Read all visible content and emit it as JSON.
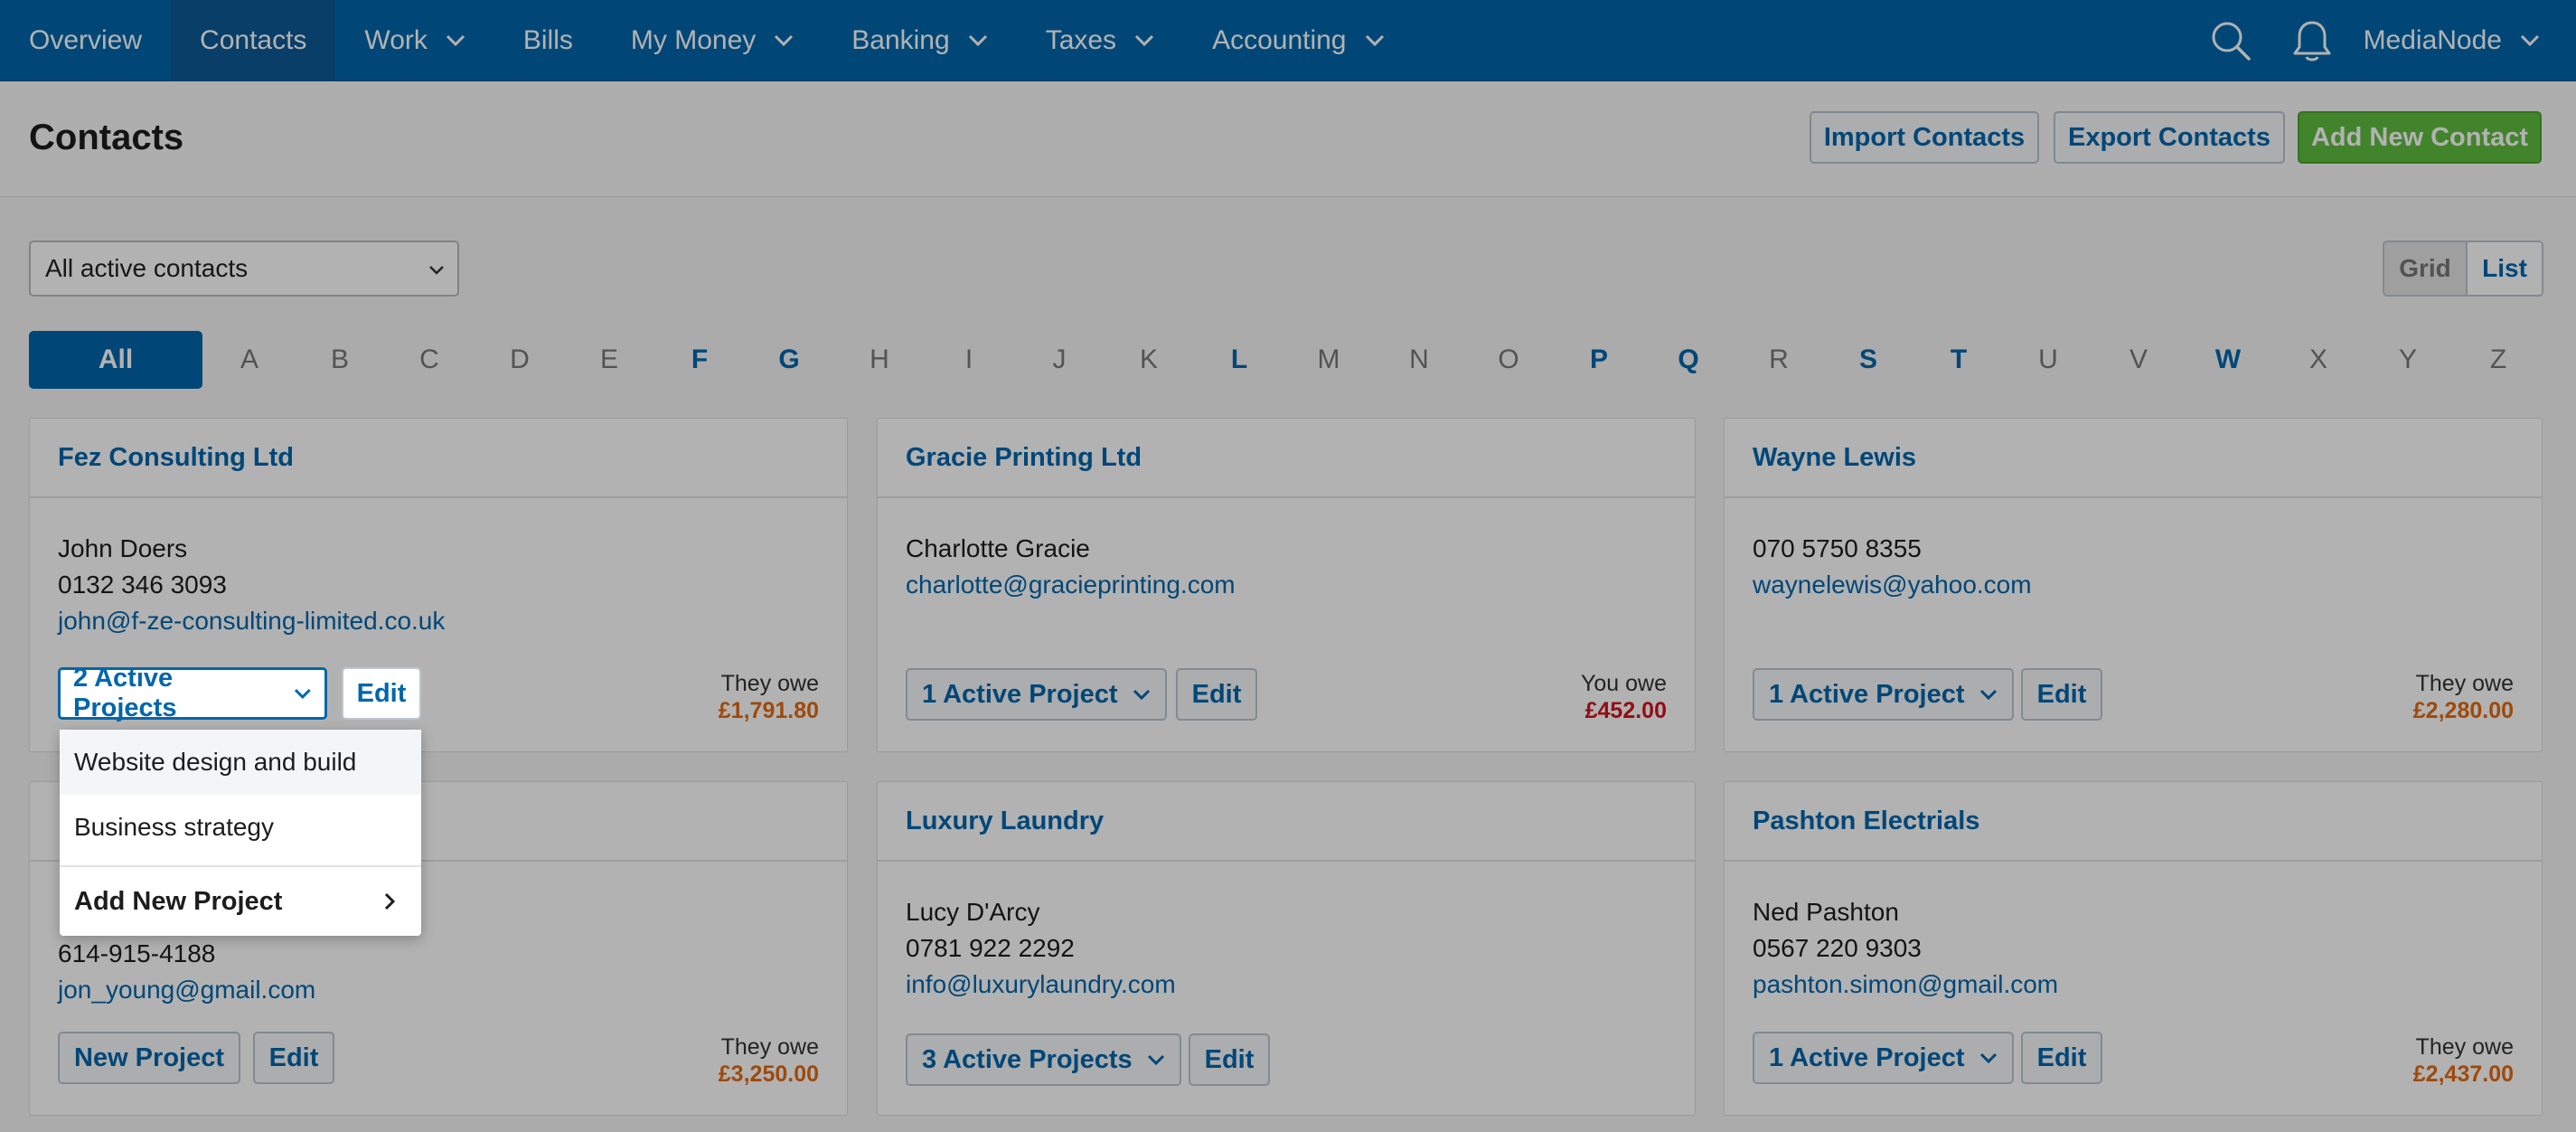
{
  "nav": {
    "items": [
      {
        "label": "Overview",
        "dropdown": false
      },
      {
        "label": "Contacts",
        "dropdown": false,
        "active": true
      },
      {
        "label": "Work",
        "dropdown": true
      },
      {
        "label": "Bills",
        "dropdown": false
      },
      {
        "label": "My Money",
        "dropdown": true
      },
      {
        "label": "Banking",
        "dropdown": true
      },
      {
        "label": "Taxes",
        "dropdown": true
      },
      {
        "label": "Accounting",
        "dropdown": true
      }
    ],
    "user": "MediaNode",
    "icons": [
      "search-icon",
      "bell-icon"
    ]
  },
  "header": {
    "title": "Contacts",
    "import_label": "Import Contacts",
    "export_label": "Export Contacts",
    "add_label": "Add New Contact"
  },
  "filter": {
    "selected": "All active contacts",
    "view_grid": "Grid",
    "view_list": "List",
    "view_active": "List"
  },
  "alphabet": {
    "all_label": "All",
    "letters": [
      {
        "l": "A",
        "on": false
      },
      {
        "l": "B",
        "on": false
      },
      {
        "l": "C",
        "on": false
      },
      {
        "l": "D",
        "on": false
      },
      {
        "l": "E",
        "on": false
      },
      {
        "l": "F",
        "on": true
      },
      {
        "l": "G",
        "on": true
      },
      {
        "l": "H",
        "on": false
      },
      {
        "l": "I",
        "on": false
      },
      {
        "l": "J",
        "on": false
      },
      {
        "l": "K",
        "on": false
      },
      {
        "l": "L",
        "on": true
      },
      {
        "l": "M",
        "on": false
      },
      {
        "l": "N",
        "on": false
      },
      {
        "l": "O",
        "on": false
      },
      {
        "l": "P",
        "on": true
      },
      {
        "l": "Q",
        "on": true
      },
      {
        "l": "R",
        "on": false
      },
      {
        "l": "S",
        "on": true
      },
      {
        "l": "T",
        "on": true
      },
      {
        "l": "U",
        "on": false
      },
      {
        "l": "V",
        "on": false
      },
      {
        "l": "W",
        "on": true
      },
      {
        "l": "X",
        "on": false
      },
      {
        "l": "Y",
        "on": false
      },
      {
        "l": "Z",
        "on": false
      }
    ]
  },
  "cards": [
    {
      "name": "Fez Consulting Ltd",
      "contact": "John Doers",
      "phone": "0132 346 3093",
      "email": "john@f-ze-consulting-limited.co.uk",
      "projects_label": "2 Active Projects",
      "edit_label": "Edit",
      "owe_label": "They owe",
      "owe_amount": "£1,791.80"
    },
    {
      "name": "Gracie Printing Ltd",
      "contact": "Charlotte Gracie",
      "email": "charlotte@graciepr​inting.com",
      "projects_label": "1 Active Project",
      "edit_label": "Edit",
      "owe_label": "You owe",
      "owe_amount": "£452.00"
    },
    {
      "name": "Wayne Lewis",
      "phone": "070 5750 8355",
      "email": "waynelewis@yahoo.com",
      "projects_label": "1 Active Project",
      "edit_label": "Edit",
      "owe_label": "They owe",
      "owe_amount": "£2,280.00"
    },
    {
      "phone": "614-915-4188",
      "email": "jon_young@gmail.com",
      "projects_label": "New Project",
      "edit_label": "Edit",
      "owe_label": "They owe",
      "owe_amount": "£3,250.00"
    },
    {
      "name": "Luxury Laundry",
      "contact": "Lucy D'Arcy",
      "phone": "0781 922 2292",
      "email": "info@luxurylaundry.com",
      "projects_label": "3 Active Projects",
      "edit_label": "Edit"
    },
    {
      "name": "Pashton Electrials",
      "contact": "Ned Pashton",
      "phone": "0567 220 9303",
      "email": "pashton.simon@gmail.com",
      "projects_label": "1 Active Project",
      "edit_label": "Edit",
      "owe_label": "They owe",
      "owe_amount": "£2,437.00"
    }
  ],
  "dropdown": {
    "items": [
      "Website design and build",
      "Business strategy"
    ],
    "add_label": "Add New Project"
  },
  "colors": {
    "brand": "#0166ac",
    "green": "#5fbd3f",
    "owe_orange": "#e36a11",
    "owe_red": "#d3131d"
  }
}
